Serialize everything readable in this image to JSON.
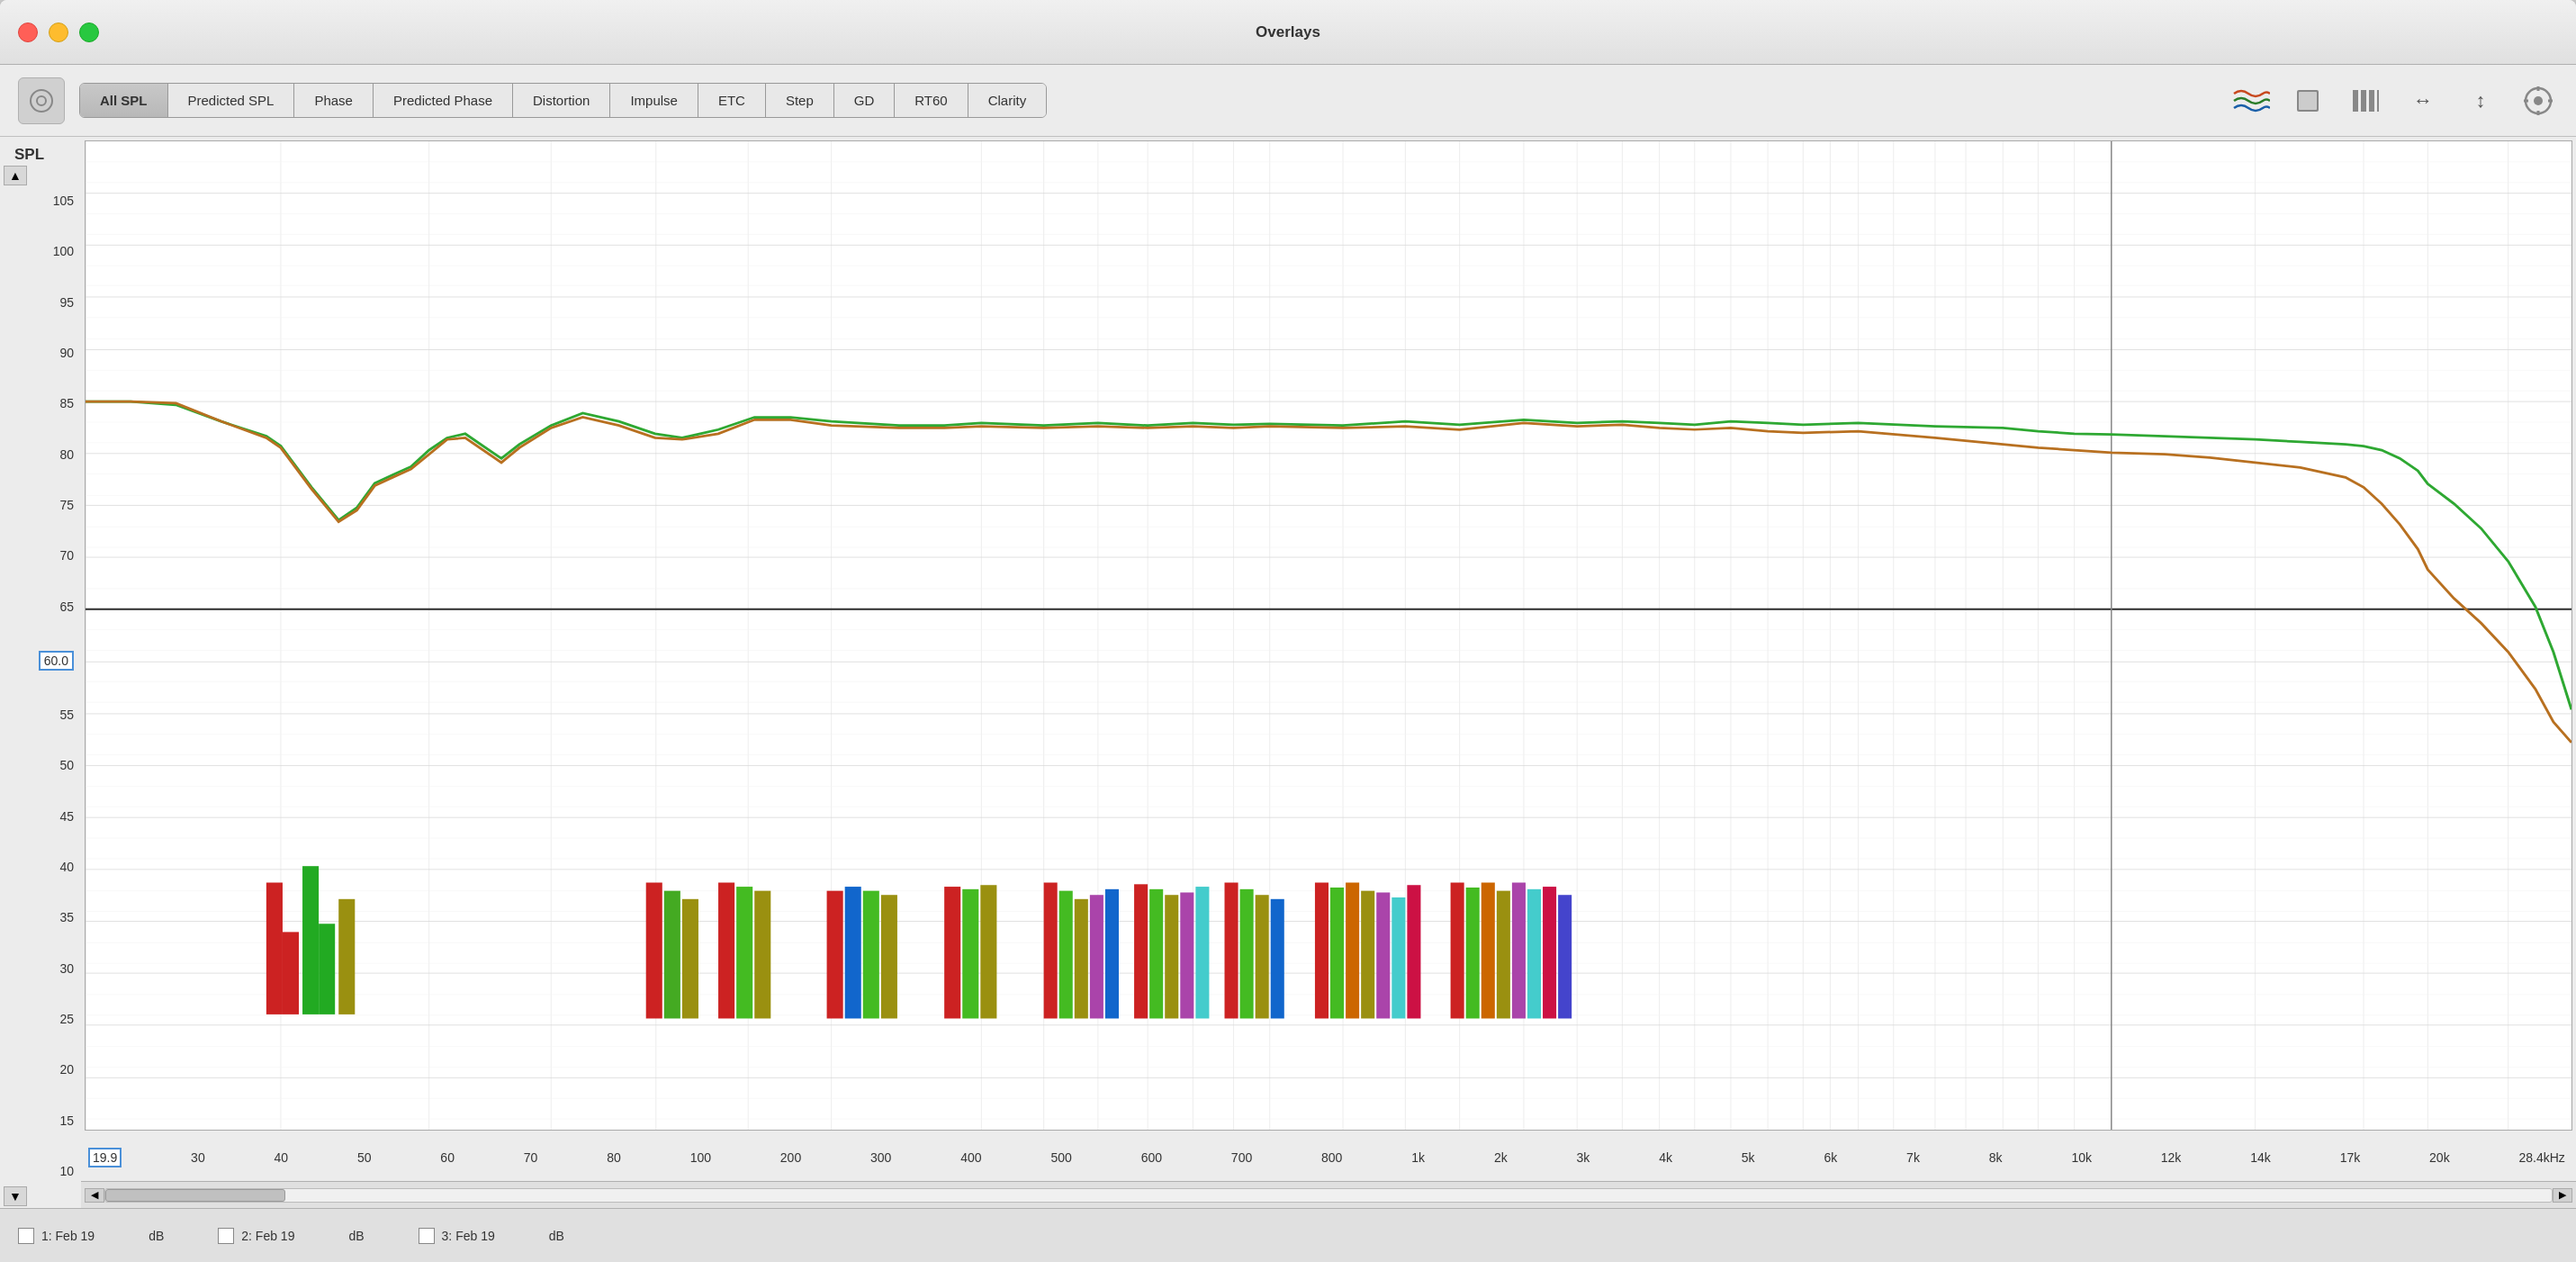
{
  "window": {
    "title": "Overlays"
  },
  "tabs": [
    {
      "label": "All SPL",
      "active": true
    },
    {
      "label": "Predicted SPL",
      "active": false
    },
    {
      "label": "Phase",
      "active": false
    },
    {
      "label": "Predicted Phase",
      "active": false
    },
    {
      "label": "Distortion",
      "active": false
    },
    {
      "label": "Impulse",
      "active": false
    },
    {
      "label": "ETC",
      "active": false
    },
    {
      "label": "Step",
      "active": false
    },
    {
      "label": "GD",
      "active": false
    },
    {
      "label": "RT60",
      "active": false
    },
    {
      "label": "Clarity",
      "active": false
    }
  ],
  "yAxis": {
    "label": "SPL",
    "values": [
      "105",
      "100",
      "95",
      "90",
      "85",
      "80",
      "75",
      "70",
      "65",
      "60",
      "55",
      "50",
      "45",
      "40",
      "35",
      "30",
      "25",
      "20",
      "15",
      "10"
    ],
    "selected": "60.0"
  },
  "xAxis": {
    "values": [
      "19.9",
      "30",
      "40",
      "50",
      "60",
      "70",
      "80",
      "100",
      "200",
      "300",
      "400",
      "500",
      "600",
      "700",
      "800",
      "1k",
      "2k",
      "3k",
      "4k",
      "5k",
      "6k",
      "7k",
      "8k",
      "10k",
      "12k",
      "14k",
      "17k",
      "20k",
      "28.4kHz"
    ]
  },
  "bottomItems": [
    {
      "label": "1: Feb 19"
    },
    {
      "label": "dB"
    },
    {
      "label": "2: Feb 19"
    },
    {
      "label": "dB"
    },
    {
      "label": "3: Feb 19"
    },
    {
      "label": "dB"
    }
  ]
}
